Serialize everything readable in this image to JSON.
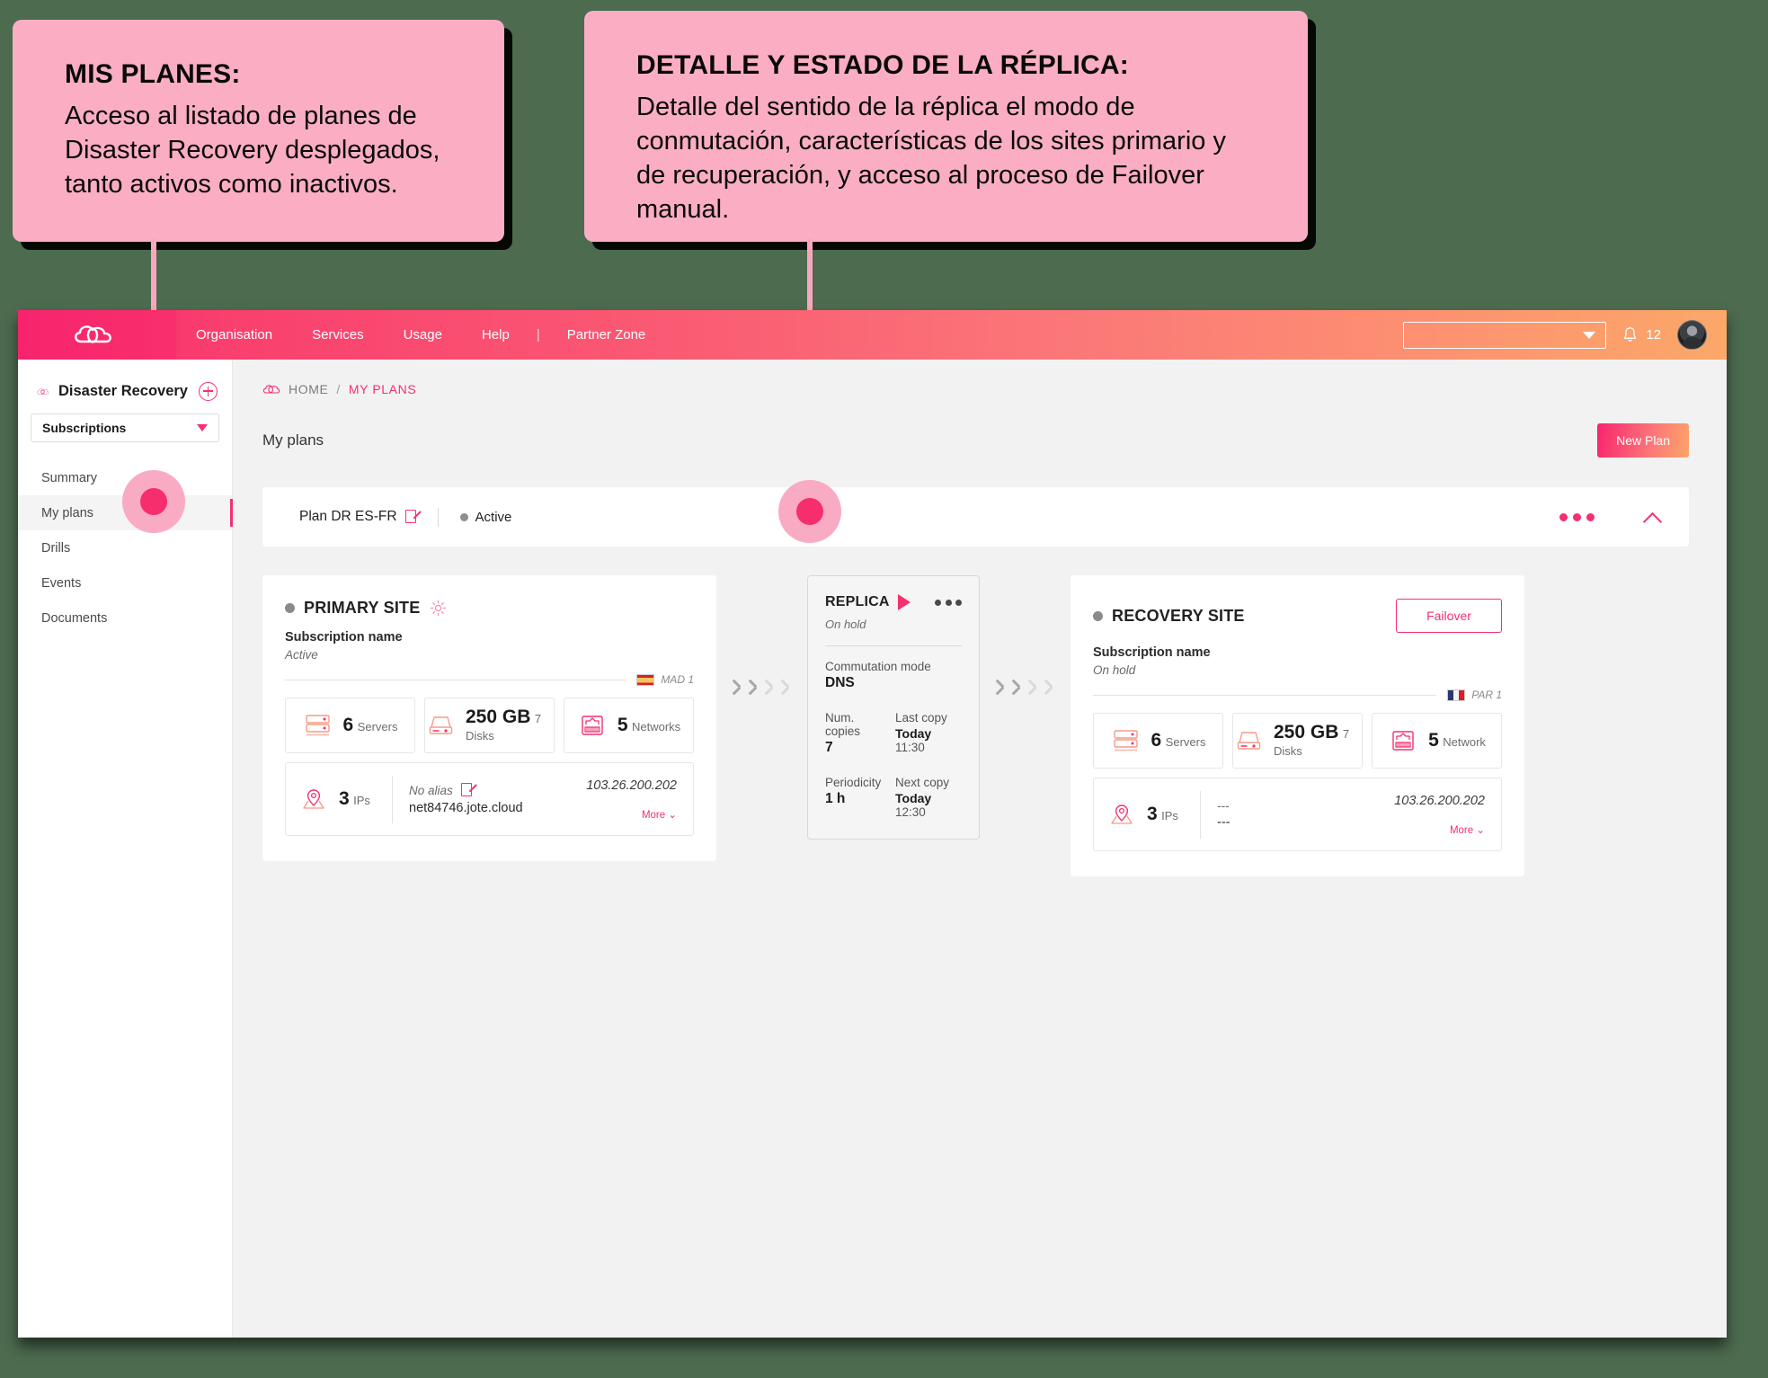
{
  "callouts": [
    {
      "title": "MIS PLANES:",
      "body": "Acceso al listado de planes de Disaster Recovery desplegados, tanto activos como inactivos."
    },
    {
      "title": "DETALLE Y ESTADO DE LA RÉPLICA:",
      "body": "Detalle del sentido de la réplica el modo de conmutación, características de los sites primario y de recuperación, y acceso al proceso de Failover manual."
    }
  ],
  "topnav": {
    "logo": "cloud-logo",
    "items": [
      "Organisation",
      "Services",
      "Usage",
      "Help"
    ],
    "separator": "|",
    "partner_zone": "Partner Zone",
    "select_value": "",
    "notifications_count": "12",
    "accent_start": "#F7246D",
    "accent_end": "#FBA869"
  },
  "sidebar": {
    "product_title": "Disaster Recovery",
    "add_label": "+",
    "select_label": "Subscriptions",
    "items": [
      {
        "label": "Summary",
        "active": false
      },
      {
        "label": "My plans",
        "active": true
      },
      {
        "label": "Drills",
        "active": false
      },
      {
        "label": "Events",
        "active": false
      },
      {
        "label": "Documents",
        "active": false
      }
    ]
  },
  "breadcrumb": {
    "home": "HOME",
    "slash": "/",
    "current": "MY PLANS"
  },
  "page": {
    "title": "My plans",
    "new_plan_label": "New Plan"
  },
  "plan": {
    "name": "Plan DR ES-FR",
    "status": "Active"
  },
  "primary_site": {
    "title": "PRIMARY SITE",
    "subscription_name": "Subscription name",
    "state": "Active",
    "flag": "flag-es",
    "region": "MAD 1",
    "stats": [
      {
        "icon": "server-icon",
        "value": "6",
        "label": "Servers"
      },
      {
        "icon": "disk-icon",
        "value": "250 GB",
        "label": "7 Disks"
      },
      {
        "icon": "network-icon",
        "value": "5",
        "label": "Networks"
      }
    ],
    "ips": {
      "icon": "location-pin-icon",
      "value": "3",
      "label": "IPs",
      "alias": "No alias",
      "host": "net84746.jote.cloud",
      "address": "103.26.200.202",
      "more": "More ⌄"
    }
  },
  "replica": {
    "title": "REPLICA",
    "state": "On hold",
    "commutation_mode_label": "Commutation mode",
    "commutation_mode_value": "DNS",
    "num_copies_label": "Num. copies",
    "num_copies_value": "7",
    "last_copy_label": "Last copy",
    "last_copy_day": "Today",
    "last_copy_time": "11:30",
    "periodicity_label": "Periodicity",
    "periodicity_value": "1 h",
    "next_copy_label": "Next copy",
    "next_copy_day": "Today",
    "next_copy_time": "12:30"
  },
  "recovery_site": {
    "title": "RECOVERY SITE",
    "failover_label": "Failover",
    "subscription_name": "Subscription name",
    "state": "On hold",
    "flag": "flag-fr",
    "region": "PAR 1",
    "stats": [
      {
        "icon": "server-icon",
        "value": "6",
        "label": "Servers"
      },
      {
        "icon": "disk-icon",
        "value": "250 GB",
        "label": "7 Disks"
      },
      {
        "icon": "network-icon",
        "value": "5",
        "label": "Network"
      }
    ],
    "ips": {
      "icon": "location-pin-icon",
      "value": "3",
      "label": "IPs",
      "alias": "---",
      "host": "---",
      "address": "103.26.200.202",
      "more": "More ⌄"
    }
  }
}
